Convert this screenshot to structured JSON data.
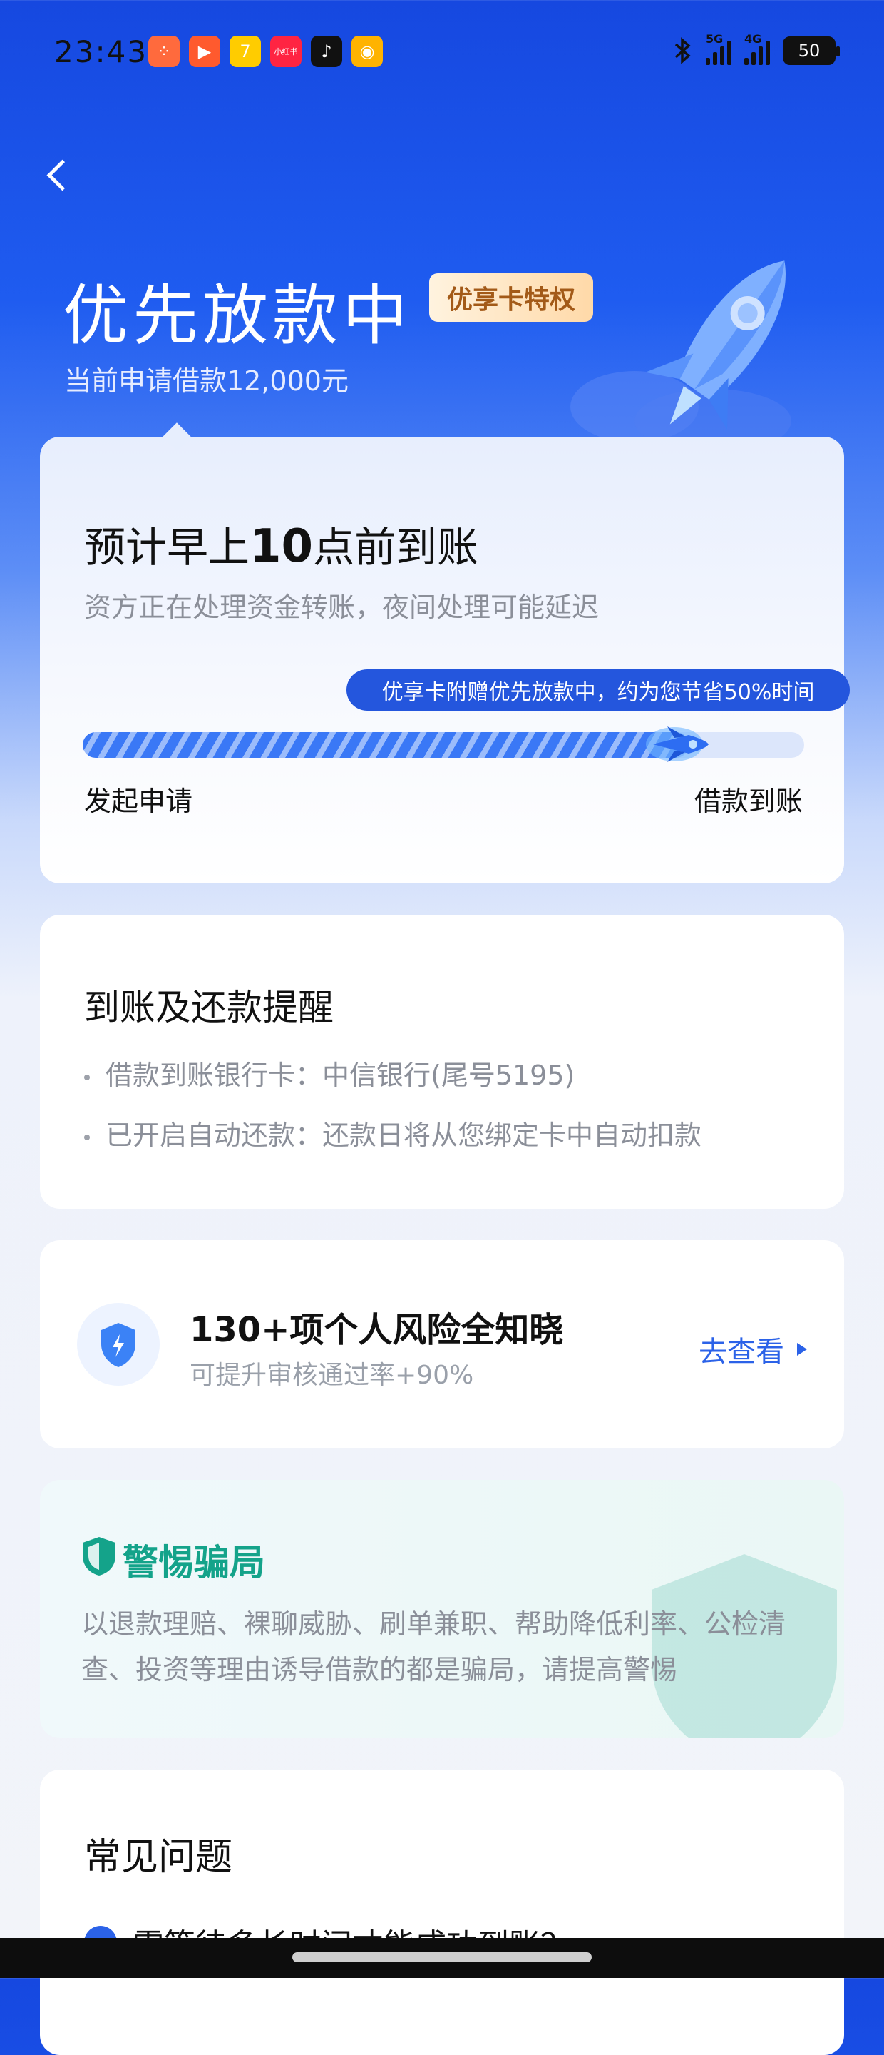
{
  "status_bar": {
    "time": "23:43",
    "apps": [
      {
        "name": "app-icon-1",
        "glyph": "⁘",
        "color": "#ff6a3d"
      },
      {
        "name": "app-icon-2",
        "glyph": "▶",
        "color": "#ff5a2e"
      },
      {
        "name": "app-icon-3",
        "glyph": "7",
        "color": "#ffcc00"
      },
      {
        "name": "app-icon-4",
        "glyph": "小红书",
        "color": "#ff2442"
      },
      {
        "name": "app-icon-5",
        "glyph": "♪",
        "color": "#111111"
      },
      {
        "name": "app-icon-6",
        "glyph": "◉",
        "color": "#ffb300"
      }
    ],
    "network_1": "5G",
    "network_2": "4G",
    "battery": "50"
  },
  "header": {
    "title": "优先放款中",
    "badge": "优享卡特权",
    "subtitle": "当前申请借款12,000元"
  },
  "progress_card": {
    "title_pre": "预计早上",
    "title_num": "10",
    "title_post": "点前到账",
    "desc": "资方正在处理资金转账，夜间处理可能延迟",
    "tip": "优享卡附赠优先放款中，约为您节省50%时间",
    "progress": 0.84,
    "start_label": "发起申请",
    "end_label": "借款到账"
  },
  "reminder_card": {
    "title": "到账及还款提醒",
    "rows": [
      "借款到账银行卡：中信银行(尾号5195)",
      "已开启自动还款：还款日将从您绑定卡中自动扣款"
    ]
  },
  "risk_card": {
    "title": "130+项个人风险全知晓",
    "subtitle": "可提升审核通过率+90%",
    "action": "去查看"
  },
  "fraud_card": {
    "title": "警惕骗局",
    "text": "以退款理赔、裸聊威胁、刷单兼职、帮助降低利率、公检清查、投资等理由诱导借款的都是骗局，请提高警惕"
  },
  "faq_card": {
    "title": "常见问题",
    "first_question": "需等待多长时间才能成功到账？"
  },
  "colors": {
    "brand_blue": "#1f5cf0",
    "accent_blue": "#2b62e8",
    "safe_green": "#14a38a",
    "badge_brown": "#a35a18"
  }
}
